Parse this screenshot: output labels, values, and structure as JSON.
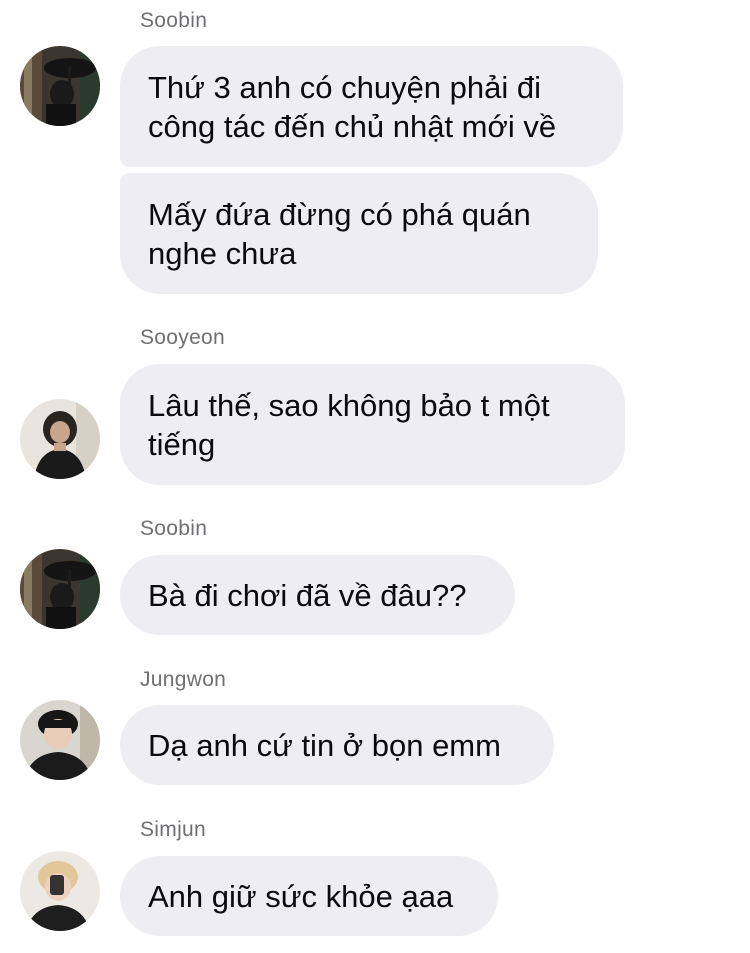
{
  "colors": {
    "bubble_bg": "#eeeef2",
    "message_text": "#0b0b0d",
    "sender_text": "#6f6f74",
    "background": "#ffffff"
  },
  "messages": [
    {
      "sender": "Soobin",
      "avatar_icon": "avatar-soobin-icon",
      "bubbles": [
        "Thứ 3 anh có chuyện phải đi\ncông tác đến chủ nhật mới về",
        "Mấy đứa đừng có phá quán\nnghe chưa"
      ]
    },
    {
      "sender": "Sooyeon",
      "avatar_icon": "avatar-sooyeon-icon",
      "bubbles": [
        "Lâu thế, sao không bảo t một\ntiếng"
      ]
    },
    {
      "sender": "Soobin",
      "avatar_icon": "avatar-soobin-icon",
      "bubbles": [
        "Bà đi chơi đã về đâu??"
      ]
    },
    {
      "sender": "Jungwon",
      "avatar_icon": "avatar-jungwon-icon",
      "bubbles": [
        "Dạ anh cứ tin ở bọn emm"
      ]
    },
    {
      "sender": "Simjun",
      "avatar_icon": "avatar-simjun-icon",
      "bubbles": [
        "Anh giữ sức khỏe ạaa"
      ]
    }
  ]
}
